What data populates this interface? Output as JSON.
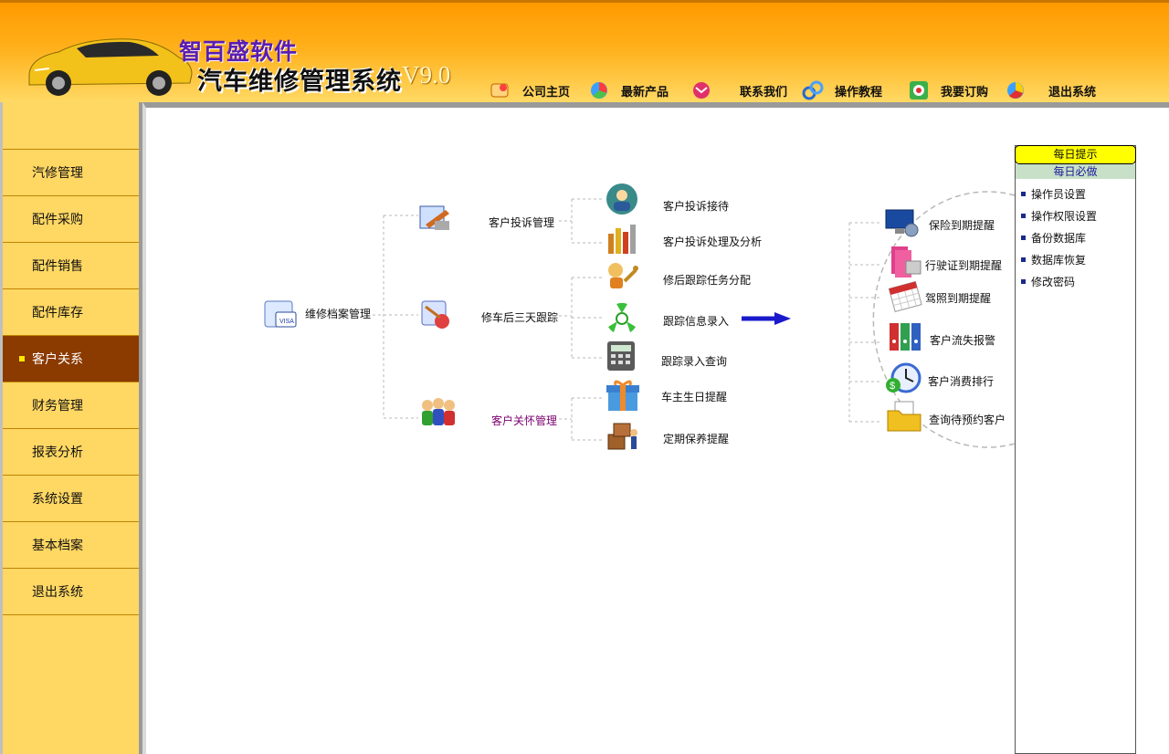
{
  "header": {
    "company": "智百盛软件",
    "product": "汽车维修管理系统",
    "version": "V9.0"
  },
  "topnav": [
    {
      "label": "公司主页",
      "icon": "home-icon"
    },
    {
      "label": "最新产品",
      "icon": "product-icon"
    },
    {
      "label": "联系我们",
      "icon": "contact-icon"
    },
    {
      "label": "操作教程",
      "icon": "tutorial-icon"
    },
    {
      "label": "我要订购",
      "icon": "order-icon"
    },
    {
      "label": "退出系统",
      "icon": "exit-icon"
    }
  ],
  "sidebar": {
    "items": [
      {
        "label": "汽修管理"
      },
      {
        "label": "配件采购"
      },
      {
        "label": "配件销售"
      },
      {
        "label": "配件库存"
      },
      {
        "label": "客户关系"
      },
      {
        "label": "财务管理"
      },
      {
        "label": "报表分析"
      },
      {
        "label": "系统设置"
      },
      {
        "label": "基本档案"
      },
      {
        "label": "退出系统"
      }
    ],
    "active": "客户关系"
  },
  "diagram": {
    "root": "维修档案管理",
    "branches": [
      {
        "label": "客户投诉管理",
        "children": [
          "客户投诉接待",
          "客户投诉处理及分析"
        ]
      },
      {
        "label": "修车后三天跟踪",
        "children": [
          "修后跟踪任务分配",
          "跟踪信息录入",
          "跟踪录入查询"
        ]
      },
      {
        "label": "客户关怀管理",
        "children": [
          "车主生日提醒",
          "定期保养提醒"
        ]
      }
    ],
    "reminders": [
      "保险到期提醒",
      "行驶证到期提醒",
      "驾照到期提醒",
      "客户流失报警",
      "客户消费排行",
      "查询待预约客户"
    ]
  },
  "tips": {
    "title": "每日提示",
    "subtitle": "每日必做",
    "items": [
      "操作员设置",
      "操作权限设置",
      "备份数据库",
      "数据库恢复",
      "修改密码"
    ]
  },
  "colors": {
    "header_top": "#ff9a00",
    "sidebar_bg": "#ffd763",
    "sidebar_active": "#8b3a00",
    "arrow": "#1a1acc",
    "tips_title_bg": "#ffff00"
  }
}
